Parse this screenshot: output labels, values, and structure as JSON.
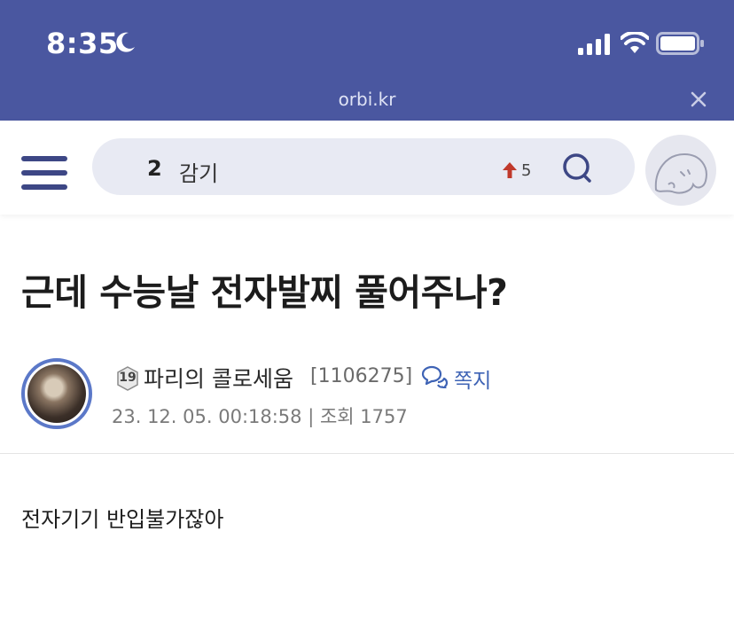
{
  "status_bar": {
    "time": "8:35"
  },
  "browser": {
    "url": "orbi.kr"
  },
  "nav": {
    "trending": {
      "rank": "2",
      "keyword": "감기",
      "change": "5"
    }
  },
  "post": {
    "title": "근데 수능날 전자발찌 풀어주나?",
    "author": {
      "level": "19",
      "name": "파리의 콜로세움",
      "id": "[1106275]",
      "message_label": "쪽지"
    },
    "meta": "23. 12. 05. 00:18:58 | 조회 1757",
    "body": "전자기기 반입불가잖아"
  },
  "colors": {
    "brand": "#4a57a0",
    "link": "#3e63b5",
    "trend_up": "#c0392b"
  },
  "icons": [
    "moon-icon",
    "signal-icon",
    "wifi-icon",
    "battery-icon",
    "close-icon",
    "menu-icon",
    "trend-up-arrow-icon",
    "search-icon",
    "level-badge-icon",
    "message-icon"
  ]
}
